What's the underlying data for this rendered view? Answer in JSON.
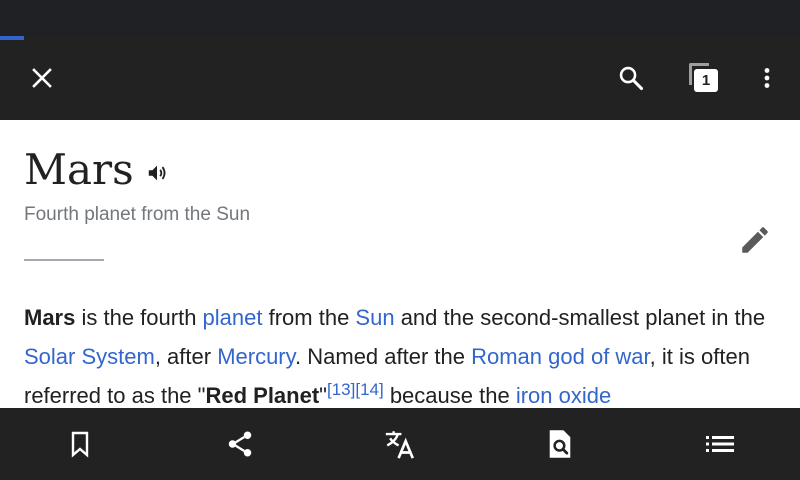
{
  "toolbar": {
    "close_icon": "close-icon",
    "search_icon": "search-icon",
    "tabs_count": "1",
    "overflow_icon": "more-vert-icon"
  },
  "load_progress_percent": 3,
  "article": {
    "title": "Mars",
    "description": "Fourth planet from the Sun",
    "body": {
      "s1_bold": "Mars",
      "s1_t1": " is the fourth ",
      "link_planet": "planet",
      "s1_t2": " from the ",
      "link_sun": "Sun",
      "s1_t3": " and the second-smallest planet in the ",
      "link_solar_system": "Solar System",
      "s1_t4": ", after ",
      "link_mercury": "Mercury",
      "s1_t5": ". Named after the ",
      "link_roman_god": "Roman god of war",
      "s1_t6": ", it is often referred to as the \"",
      "s1_bold2": "Red Planet",
      "s1_t7": "\"",
      "ref_13": "[13]",
      "ref_14": "[14]",
      "s1_t8": " because the ",
      "link_iron_oxide": "iron oxide"
    }
  },
  "bottom_bar": {
    "items": [
      "bookmark-icon",
      "share-icon",
      "translate-icon",
      "find-in-page-icon",
      "contents-icon"
    ]
  },
  "colors": {
    "toolbar_bg": "#222222",
    "link": "#3366cc",
    "text": "#202122",
    "muted": "#72777d"
  }
}
